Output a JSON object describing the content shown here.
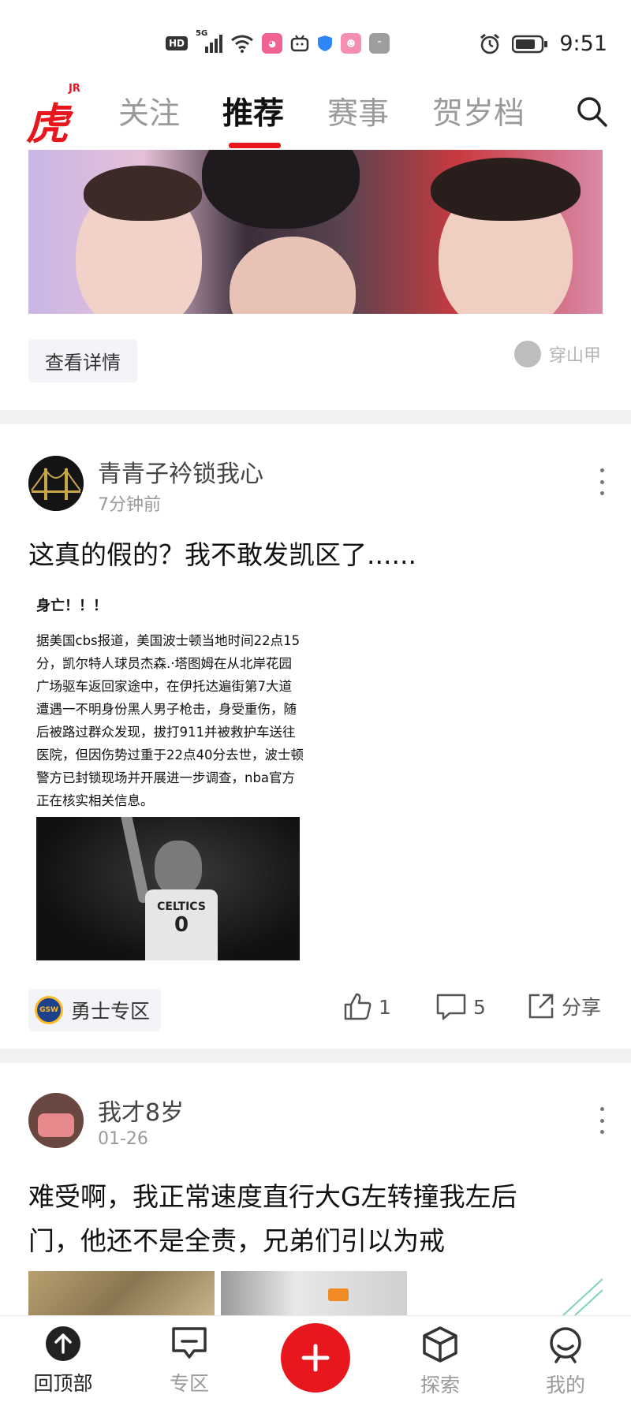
{
  "status_bar": {
    "network_badge": "HD",
    "signal_label": "5G",
    "time": "9:51"
  },
  "top_nav": {
    "logo_text": "虎扑",
    "logo_tag": "JR",
    "tabs": [
      {
        "label": "关注",
        "active": false
      },
      {
        "label": "推荐",
        "active": true
      },
      {
        "label": "赛事",
        "active": false
      },
      {
        "label": "贺岁档",
        "active": false
      }
    ],
    "accent_color": "#e8161d"
  },
  "ad": {
    "detail_button": "查看详情",
    "source": "穿山甲"
  },
  "posts": [
    {
      "author": "青青子衿锁我心",
      "time": "7分钟前",
      "title": "这真的假的？我不敢发凯区了......",
      "article_image": {
        "headline": "身亡！！！",
        "body": "据美国cbs报道，美国波士顿当地时间22点15分，凯尔特人球员杰森.·塔图姆在从北岸花园广场驱车返回家途中，在伊托达遍街第7大道遭遇一不明身份黑人男子枪击，身受重伤，随后被路过群众发现，拔打911并被救护车送往医院，但因伤势过重于22点40分去世，波士顿警方已封锁现场并开展进一步调查，nba官方正在核实相关信息。",
        "jersey_text": "CELTICS",
        "jersey_number": "0"
      },
      "zone": {
        "icon_text": "GSW",
        "label": "勇士专区"
      },
      "likes": "1",
      "comments": "5",
      "share_label": "分享"
    },
    {
      "author": "我才8岁",
      "time": "01-26",
      "title_line1": "难受啊，我正常速度直行大G左转撞我左后",
      "title_line2": "门，他还不是全责，兄弟们引以为戒"
    }
  ],
  "bottom_bar": {
    "items": [
      {
        "label": "回顶部",
        "icon": "arrow-up-circle-icon",
        "active": true
      },
      {
        "label": "专区",
        "icon": "chat-bubble-icon",
        "active": false
      },
      {
        "label": "探索",
        "icon": "cube-icon",
        "active": false
      },
      {
        "label": "我的",
        "icon": "smiley-face-icon",
        "active": false
      }
    ],
    "fab_icon": "plus-icon"
  }
}
